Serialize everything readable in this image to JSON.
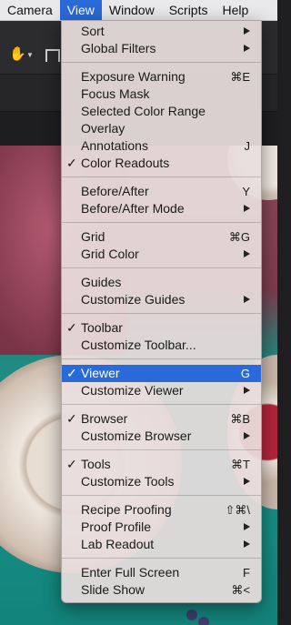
{
  "menubar": {
    "items": [
      "Camera",
      "View",
      "Window",
      "Scripts",
      "Help"
    ],
    "active_index": 1
  },
  "menu": {
    "groups": [
      [
        {
          "label": "Sort",
          "shortcut": "",
          "submenu": true,
          "checked": false
        },
        {
          "label": "Global Filters",
          "shortcut": "",
          "submenu": true,
          "checked": false
        }
      ],
      [
        {
          "label": "Exposure Warning",
          "shortcut": "⌘E",
          "submenu": false,
          "checked": false
        },
        {
          "label": "Focus Mask",
          "shortcut": "",
          "submenu": false,
          "checked": false
        },
        {
          "label": "Selected Color Range",
          "shortcut": "",
          "submenu": false,
          "checked": false
        },
        {
          "label": "Overlay",
          "shortcut": "",
          "submenu": false,
          "checked": false
        },
        {
          "label": "Annotations",
          "shortcut": "J",
          "submenu": false,
          "checked": false
        },
        {
          "label": "Color Readouts",
          "shortcut": "",
          "submenu": false,
          "checked": true
        }
      ],
      [
        {
          "label": "Before/After",
          "shortcut": "Y",
          "submenu": false,
          "checked": false
        },
        {
          "label": "Before/After Mode",
          "shortcut": "",
          "submenu": true,
          "checked": false
        }
      ],
      [
        {
          "label": "Grid",
          "shortcut": "⌘G",
          "submenu": false,
          "checked": false
        },
        {
          "label": "Grid Color",
          "shortcut": "",
          "submenu": true,
          "checked": false
        }
      ],
      [
        {
          "label": "Guides",
          "shortcut": "",
          "submenu": false,
          "checked": false
        },
        {
          "label": "Customize Guides",
          "shortcut": "",
          "submenu": true,
          "checked": false
        }
      ],
      [
        {
          "label": "Toolbar",
          "shortcut": "",
          "submenu": false,
          "checked": true
        },
        {
          "label": "Customize Toolbar...",
          "shortcut": "",
          "submenu": false,
          "checked": false
        }
      ],
      [
        {
          "label": "Viewer",
          "shortcut": "G",
          "submenu": false,
          "checked": true,
          "highlighted": true
        },
        {
          "label": "Customize Viewer",
          "shortcut": "",
          "submenu": true,
          "checked": false
        }
      ],
      [
        {
          "label": "Browser",
          "shortcut": "⌘B",
          "submenu": false,
          "checked": true
        },
        {
          "label": "Customize Browser",
          "shortcut": "",
          "submenu": true,
          "checked": false
        }
      ],
      [
        {
          "label": "Tools",
          "shortcut": "⌘T",
          "submenu": false,
          "checked": true
        },
        {
          "label": "Customize Tools",
          "shortcut": "",
          "submenu": true,
          "checked": false
        }
      ],
      [
        {
          "label": "Recipe Proofing",
          "shortcut": "⇧⌘\\",
          "submenu": false,
          "checked": false
        },
        {
          "label": "Proof Profile",
          "shortcut": "",
          "submenu": true,
          "checked": false
        },
        {
          "label": "Lab Readout",
          "shortcut": "",
          "submenu": true,
          "checked": false
        }
      ],
      [
        {
          "label": "Enter Full Screen",
          "shortcut": "F",
          "submenu": false,
          "checked": false
        },
        {
          "label": "Slide Show",
          "shortcut": "⌘<",
          "submenu": false,
          "checked": false
        }
      ]
    ]
  },
  "toolbar": {
    "pan_icon": "hand-icon",
    "caret_icon": "caret-down-icon",
    "second_icon": "tool-icon"
  },
  "colors": {
    "highlight": "#2a6ad8",
    "pan_tool": "#e49a2a"
  }
}
